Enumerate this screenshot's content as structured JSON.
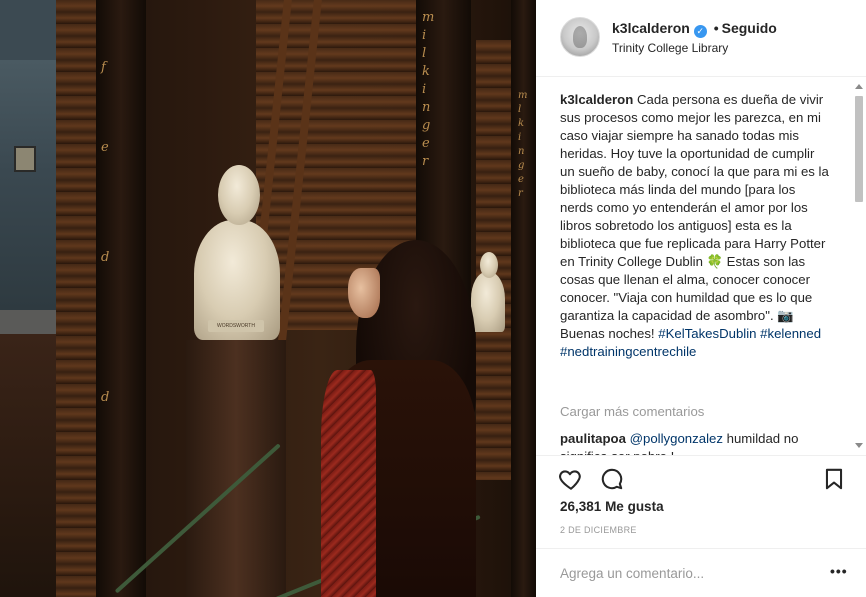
{
  "post": {
    "username": "k3lcalderon",
    "follow_status": "Seguido",
    "separator": "•",
    "location": "Trinity College Library",
    "verified_icon": "verified-badge-icon",
    "accent_color": "#3897f0"
  },
  "caption": {
    "username": "k3lcalderon",
    "text": "Cada persona es dueña de vivir sus procesos como mejor les parezca, en mi caso viajar siempre ha sanado todas mis heridas. Hoy tuve la oportunidad de cumplir un sueño de baby, conocí la que para mi es la biblioteca más linda del mundo [para los nerds como yo entenderán el amor por los libros sobretodo los antiguos] esta es la biblioteca que fue replicada para Harry Potter en Trinity College Dublin 🍀 Estas son las cosas que llenan el alma, conocer conocer conocer. \"Viaja con humildad que es lo que garantiza la capacidad de asombro\". 📷 Buenas noches!",
    "hashtags": [
      "#KelTakesDublin",
      "#kelenned",
      "#nedtrainingcentrechile"
    ]
  },
  "comments": {
    "load_more": "Cargar más comentarios",
    "items": [
      {
        "username": "paulitapoa",
        "mention": "@pollygonzalez",
        "text": "humildad no significa ser pobre !"
      }
    ]
  },
  "actions": {
    "like_icon": "heart-icon",
    "comment_icon": "comment-icon",
    "save_icon": "bookmark-icon"
  },
  "stats": {
    "likes_count": "26,381",
    "likes_label": "Me gusta",
    "date": "2 DE DICIEMBRE"
  },
  "composer": {
    "placeholder": "Agrega un comentario...",
    "more_label": "•••",
    "more_icon": "more-options-icon"
  },
  "photo": {
    "spine_letters_left": [
      "f",
      "e",
      "d",
      "d"
    ],
    "spine_letters_mid": [
      "m",
      "i",
      "l",
      "k",
      "i",
      "n",
      "g",
      "e",
      "r"
    ],
    "spine_letters_right": [
      "m",
      "l",
      "k",
      "i",
      "n",
      "g",
      "e",
      "r"
    ],
    "plaque": "WORDSWORTH"
  }
}
